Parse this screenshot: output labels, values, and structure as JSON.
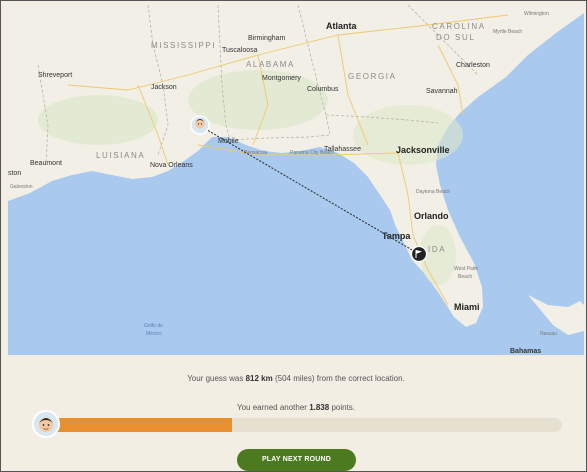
{
  "map": {
    "states": {
      "mississippi": "MISSISSIPPI",
      "alabama": "ALABAMA",
      "georgia": "GEORGIA",
      "louisiana": "LUISIANA",
      "carolina": "CAROLINA",
      "do_sul": "DO SUL",
      "florida_partial": "IDA"
    },
    "cities": {
      "atlanta": "Atlanta",
      "birmingham": "Birmingham",
      "tuscaloosa": "Tuscaloosa",
      "montgomery": "Montgomery",
      "columbus": "Columbus",
      "shreveport": "Shreveport",
      "jackson": "Jackson",
      "mobile": "Mobile",
      "pensacola": "Pensacola",
      "panama_city": "Panama City Beach",
      "tallahassee": "Tallahassee",
      "jacksonville": "Jacksonville",
      "savannah": "Savannah",
      "charleston": "Charleston",
      "myrtle_beach": "Myrtle Beach",
      "wilmington": "Wilmington",
      "beaumont": "Beaumont",
      "houston_partial": "ston",
      "galveston": "Galveston",
      "new_orleans": "Nova Orleans",
      "daytona": "Daytona Beach",
      "orlando": "Orlando",
      "tampa": "Tampa",
      "west_palm": "West Palm",
      "west_palm_2": "Beach",
      "miami": "Miami",
      "nassau": "Nassau",
      "bahamas": "Bahamas"
    },
    "water": {
      "gulf_1": "Golfo do",
      "gulf_2": "México"
    },
    "guess_marker_icon": "player-avatar",
    "correct_marker_icon": "flag"
  },
  "result": {
    "guess_prefix": "Your guess was ",
    "distance_km": "812 km",
    "distance_miles": " (504 miles) ",
    "guess_suffix": "from the correct location.",
    "earned_prefix": "You earned another ",
    "points": "1.838",
    "earned_suffix": " points.",
    "score_fraction": 0.358,
    "play_button": "PLAY NEXT ROUND"
  },
  "colors": {
    "progress": "#e8902f",
    "button": "#4b7a1f",
    "water": "#a9c9ee",
    "land": "#f2efe6"
  }
}
